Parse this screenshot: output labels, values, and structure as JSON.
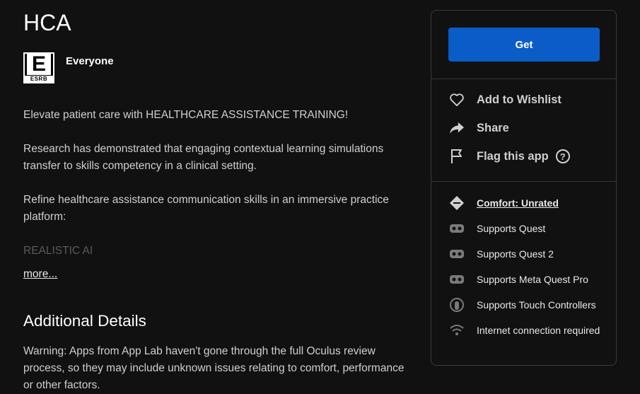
{
  "app": {
    "title": "HCA",
    "rating": {
      "badge_letter": "E",
      "badge_org": "ESRB",
      "label": "Everyone"
    }
  },
  "description": {
    "paragraphs": [
      "Elevate patient care with HEALTHCARE ASSISTANCE TRAINING!",
      "Research has demonstrated that engaging contextual learning simulations transfer to skills competency in a clinical setting.",
      "Refine healthcare assistance communication skills in an immersive practice platform:"
    ],
    "faded": "REALISTIC AI",
    "more_link": "more..."
  },
  "additional": {
    "heading": "Additional Details",
    "warning": "Warning: Apps from App Lab haven't gone through the full Oculus review process, so they may include unknown issues relating to comfort, performance or other factors."
  },
  "sidebar": {
    "get_label": "Get",
    "actions": {
      "wishlist": "Add to Wishlist",
      "share": "Share",
      "flag": "Flag this app",
      "help_symbol": "?"
    },
    "features": {
      "comfort": "Comfort: Unrated",
      "quest": "Supports Quest",
      "quest2": "Supports Quest 2",
      "questpro": "Supports Meta Quest Pro",
      "touch": "Supports Touch Controllers",
      "internet": "Internet connection required"
    }
  },
  "colors": {
    "background": "#111111",
    "accent": "#0a5cc6",
    "border": "#3a3a3a"
  },
  "icons": [
    "heart-icon",
    "share-icon",
    "flag-icon",
    "help-icon",
    "comfort-diamond-icon",
    "headset-icon",
    "touch-controller-icon",
    "wifi-icon"
  ]
}
